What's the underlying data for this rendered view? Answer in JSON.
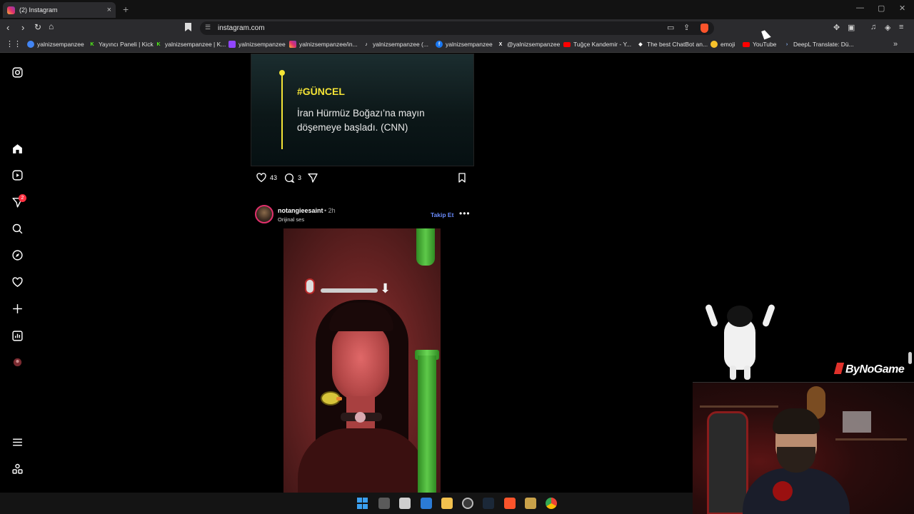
{
  "browser": {
    "tab_title": "(2) Instagram",
    "tab_close": "×",
    "new_tab": "+",
    "url": "instagram.com",
    "window_controls": [
      "—",
      "▢",
      "✕"
    ],
    "bookmarks": [
      {
        "label": "yalnizsempanzee",
        "icon": "chrome-icon",
        "color": "#8ab4f8"
      },
      {
        "label": "Yayıncı Paneli | Kick",
        "icon": "kick-icon",
        "color": "#53fc18"
      },
      {
        "label": "yalnizsempanzee | K...",
        "icon": "kick-icon",
        "color": "#53fc18"
      },
      {
        "label": "yalnizsempanzee",
        "icon": "twitch-icon",
        "color": "#9146ff"
      },
      {
        "label": "yalnizsempanzee/in...",
        "icon": "instagram-icon",
        "color": "#e1306c"
      },
      {
        "label": "yalnizsempanzee (...",
        "icon": "tiktok-icon",
        "color": "#ffffff"
      },
      {
        "label": "yalnizsempanzee",
        "icon": "facebook-icon",
        "color": "#1877f2"
      },
      {
        "label": "@yalnizsempanzee",
        "icon": "x-icon",
        "color": "#ffffff"
      },
      {
        "label": "Tuğçe Kandemir - Y...",
        "icon": "youtube-icon",
        "color": "#ff0000"
      },
      {
        "label": "The best ChatBot an...",
        "icon": "chatbot-icon",
        "color": "#ffffff"
      },
      {
        "label": "emoji",
        "icon": "emoji-icon",
        "color": "#f7c22b"
      },
      {
        "label": "YouTube",
        "icon": "youtube-icon",
        "color": "#ff0000"
      },
      {
        "label": "DeepL Translate: Dü...",
        "icon": "deepl-icon",
        "color": "#0f2b46"
      }
    ]
  },
  "nav": {
    "notification_count": "2"
  },
  "post1": {
    "tag": "#GÜNCEL",
    "headline": "İran Hürmüz Boğazı’na mayın döşemeye başladı. (CNN)",
    "likes": "43",
    "comments": "3"
  },
  "post2": {
    "username": "notangieesaint",
    "time": "• 2h",
    "audio": "Orijinal ses",
    "follow_label": "Takip Et",
    "more_label": "•••"
  },
  "overlay": {
    "brand": "ByNoGame"
  },
  "colors": {
    "accent_yellow": "#f4e436",
    "follow_blue": "#6a8cff",
    "badge_red": "#ff3040"
  }
}
